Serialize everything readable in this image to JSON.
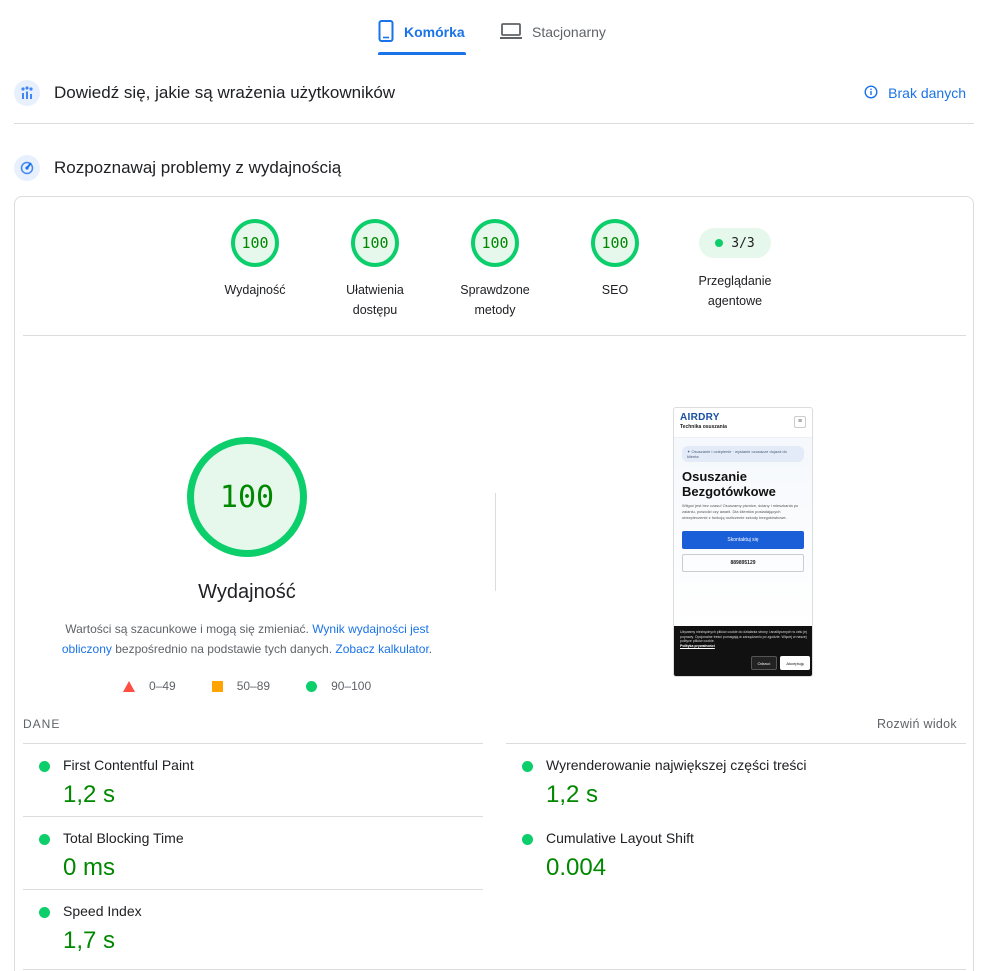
{
  "tabs": [
    {
      "label": "Komórka",
      "icon": "smartphone-icon",
      "active": true
    },
    {
      "label": "Stacjonarny",
      "icon": "laptop-icon",
      "active": false
    }
  ],
  "field_section": {
    "title": "Dowiedź się, jakie są wrażenia użytkowników",
    "no_data_label": "Brak danych"
  },
  "lab_section": {
    "title": "Rozpoznawaj problemy z wydajnością"
  },
  "categories": [
    {
      "score": "100",
      "label_line1": "Wydajność",
      "label_line2": ""
    },
    {
      "score": "100",
      "label_line1": "Ułatwienia",
      "label_line2": "dostępu"
    },
    {
      "score": "100",
      "label_line1": "Sprawdzone",
      "label_line2": "metody"
    },
    {
      "score": "100",
      "label_line1": "SEO",
      "label_line2": ""
    },
    {
      "score": "3/3",
      "label_line1": "Przeglądanie",
      "label_line2": "agentowe"
    }
  ],
  "performance": {
    "score": "100",
    "label": "Wydajność",
    "note_prefix": "Wartości są szacunkowe i mogą się zmieniać. ",
    "note_link1": "Wynik wydajności jest obliczony",
    "note_middle": " bezpośrednio na podstawie tych danych. ",
    "note_link2": "Zobacz kalkulator",
    "note_suffix": "."
  },
  "legend": {
    "fail": "0–49",
    "average": "50–89",
    "pass": "90–100"
  },
  "screenshot": {
    "logo": "AIRDRY",
    "logo_sub": "Technika osuszania",
    "badge": "✦ Osuszanie i ocieplenie · wysłanie ozusacze dojazd do klienta",
    "title_line1": "Osuszanie",
    "title_line2": "Bezgotówkowe",
    "text": "Wilgoć jest bez czasu! Osuszamy piwnice, ściany i mieszkania po zalaniu, powodzi czy awarii. Dla klientów posiadających ubezpieczenie z funkcją rozliczenie szkody bezgotówkowe.",
    "btn_primary": "Skontaktuj się",
    "btn_secondary": "889895129",
    "cookie_text": "Używamy niezbędnych plików cookie do działania strony i analitycznych w celu jej poprawy. Opcjonalne treści pomagają w zarządzaniu po zgodzie. Więcej w naszej polityce plików cookie.",
    "cookie_link": "Polityka prywatności",
    "cookie_reject": "Odrzuć",
    "cookie_accept": "Akceptuję"
  },
  "metrics_header": {
    "label": "DANE",
    "expand": "Rozwiń widok"
  },
  "metrics": [
    {
      "name": "First Contentful Paint",
      "value": "1,2 s"
    },
    {
      "name": "Wyrenderowanie największej części treści",
      "value": "1,2 s"
    },
    {
      "name": "Total Blocking Time",
      "value": "0 ms"
    },
    {
      "name": "Cumulative Layout Shift",
      "value": "0.004"
    },
    {
      "name": "Speed Index",
      "value": "1,7 s"
    }
  ],
  "colors": {
    "accent": "#1a73e8",
    "pass": "#0cce6b",
    "pass_text": "#008800",
    "average": "#ffa400",
    "fail": "#ff4e42"
  }
}
